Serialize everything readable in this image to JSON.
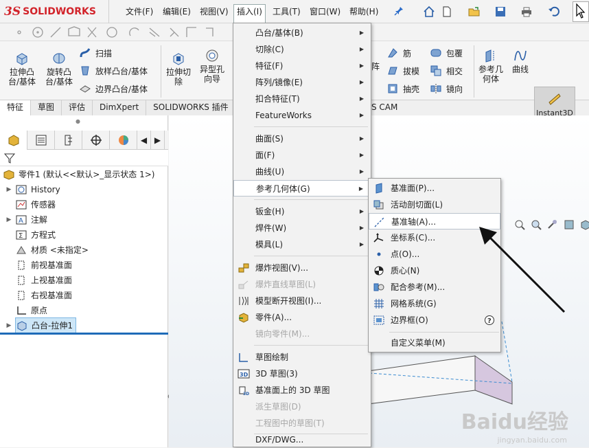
{
  "app": {
    "logo_ds": "3S",
    "logo_name": "SOLIDWORKS"
  },
  "menubar": {
    "items": [
      "文件(F)",
      "编辑(E)",
      "视图(V)",
      "插入(I)",
      "工具(T)",
      "窗口(W)",
      "帮助(H)"
    ],
    "active": "插入(I)"
  },
  "ribbon": {
    "extrude": "拉伸凸\n台/基体",
    "revolve": "旋转凸\n台/基体",
    "sweep": "扫描",
    "loft": "放样凸台/基体",
    "boundary": "边界凸台/基体",
    "extrude_cut": "拉伸切\n除",
    "hole_wizard": "异型孔\n向导",
    "array_partial": "阵",
    "rib": "筋",
    "wrap": "包覆",
    "draft": "拔模",
    "intersect": "相交",
    "shell": "抽壳",
    "mirror": "镜向",
    "ref_geometry": "参考几\n何体",
    "curves": "曲线",
    "instant3d": "Instant3D"
  },
  "tabs": [
    "特征",
    "草图",
    "评估",
    "DimXpert",
    "SOLIDWORKS 插件"
  ],
  "tab_partial": "S CAM",
  "tree": {
    "root": "零件1 (默认<<默认>_显示状态 1>)",
    "items": [
      "History",
      "传感器",
      "注解",
      "方程式",
      "材质 <未指定>",
      "前视基准面",
      "上视基准面",
      "右视基准面",
      "原点",
      "凸台-拉伸1"
    ]
  },
  "insert_menu": {
    "items": [
      "凸台/基体(B)",
      "切除(C)",
      "特征(F)",
      "阵列/镜像(E)",
      "扣合特征(T)",
      "FeatureWorks",
      "曲面(S)",
      "面(F)",
      "曲线(U)",
      "参考几何体(G)",
      "钣金(H)",
      "焊件(W)",
      "模具(L)",
      "爆炸视图(V)...",
      "爆炸直线草图(L)",
      "模型断开视图(I)...",
      "零件(A)...",
      "镜向零件(M)...",
      "草图绘制",
      "3D 草图(3)",
      "基准面上的 3D 草图",
      "派生草图(D)",
      "工程图中的草图(T)",
      "DXF/DWG..."
    ]
  },
  "ref_geometry_menu": {
    "items": [
      "基准面(P)...",
      "活动剖切面(L)",
      "基准轴(A)...",
      "坐标系(C)...",
      "点(O)...",
      "质心(N)",
      "配合参考(M)...",
      "网格系统(G)",
      "边界框(O)",
      "自定义菜单(M)"
    ]
  },
  "watermark": {
    "text": "Baidu经验",
    "url": "jingyan.baidu.com"
  },
  "colors": {
    "accent": "#1e6bb8",
    "logo": "#d2232a",
    "highlight_arrow": "#111111"
  }
}
